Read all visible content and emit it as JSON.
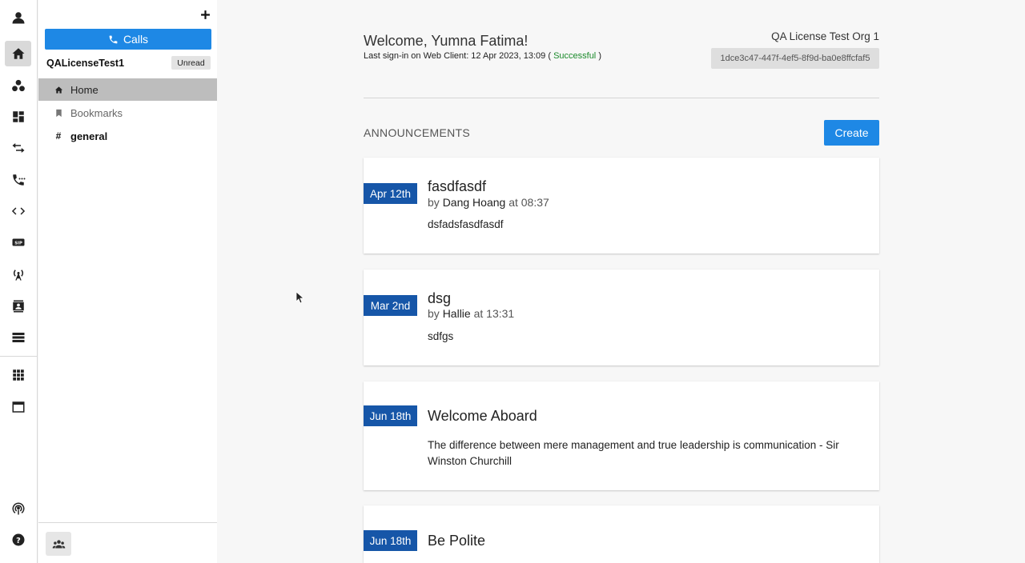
{
  "sidebar": {
    "calls_label": "Calls",
    "org_name": "QALicenseTest1",
    "unread_label": "Unread",
    "items": [
      {
        "label": "Home",
        "icon": "home-icon"
      },
      {
        "label": "Bookmarks",
        "icon": "bookmark-icon"
      },
      {
        "label": "general",
        "icon": "hash-icon"
      }
    ]
  },
  "header": {
    "welcome": "Welcome, Yumna Fatima!",
    "last_signin_prefix": "Last sign-in on Web Client: 12 Apr 2023, 13:09 (",
    "last_signin_status": "Successful",
    "last_signin_suffix": ")",
    "org_title": "QA License Test Org 1",
    "org_id": "1dce3c47-447f-4ef5-8f9d-ba0e8ffcfaf5"
  },
  "announcements": {
    "title": "ANNOUNCEMENTS",
    "create_label": "Create",
    "items": [
      {
        "date": "Apr 12th",
        "title": "fasdfasdf",
        "by": "by",
        "author": "Dang Hoang",
        "at": "at 08:37",
        "body": "dsfadsfasdfasdf"
      },
      {
        "date": "Mar 2nd",
        "title": "dsg",
        "by": "by",
        "author": "Hallie",
        "at": "at 13:31",
        "body": "sdfgs"
      },
      {
        "date": "Jun 18th",
        "title": "Welcome Aboard",
        "body": "The difference between mere management and true leadership is communication - Sir Winston Churchill"
      },
      {
        "date": "Jun 18th",
        "title": "Be Polite"
      }
    ]
  },
  "colors": {
    "accent": "#1e88e5",
    "date_tag": "#1656a8",
    "success": "#1a8a2a"
  }
}
